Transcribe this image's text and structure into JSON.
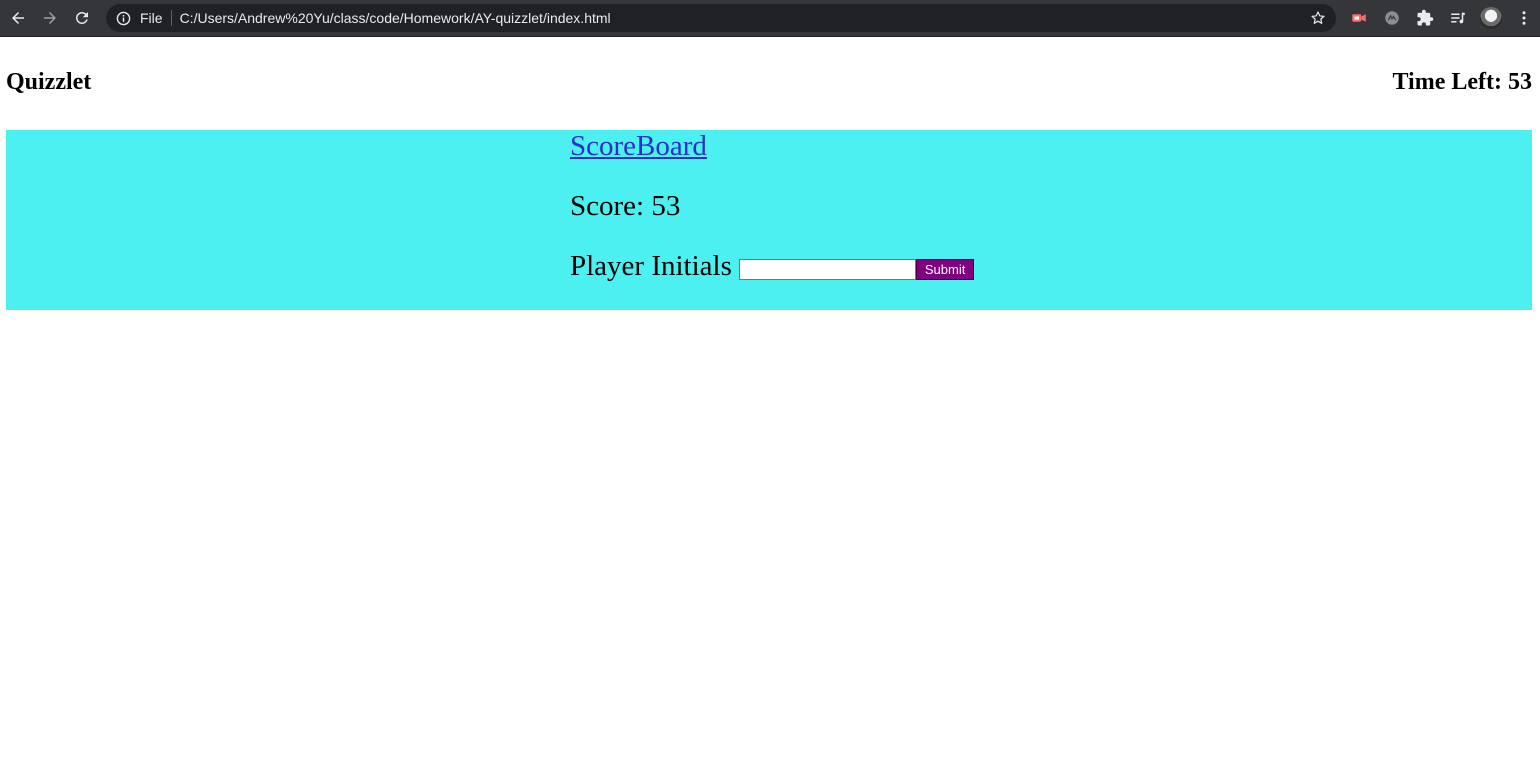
{
  "browser": {
    "url_scheme": "File",
    "url": "C:/Users/Andrew%20Yu/class/code/Homework/AY-quizzlet/index.html",
    "icons": [
      "back-arrow-icon",
      "forward-arrow-icon",
      "reload-icon",
      "info-icon",
      "star-icon",
      "video-extension-icon",
      "grammar-extension-icon",
      "puzzle-extensions-icon",
      "reading-list-icon",
      "profile-avatar",
      "kebab-menu-icon"
    ]
  },
  "header": {
    "title": "Quizzlet",
    "timer_text": "Time Left: 53"
  },
  "scoreboard": {
    "link_text": "ScoreBoard",
    "score_text": "Score: 53",
    "initials_label": "Player Initials",
    "initials_value": "",
    "initials_placeholder": "",
    "submit_label": "Submit"
  },
  "colors": {
    "panel_background": "#4df0f0",
    "submit_background": "#800080",
    "link_color": "#2e2ec8",
    "browser_chrome": "#35363a"
  }
}
